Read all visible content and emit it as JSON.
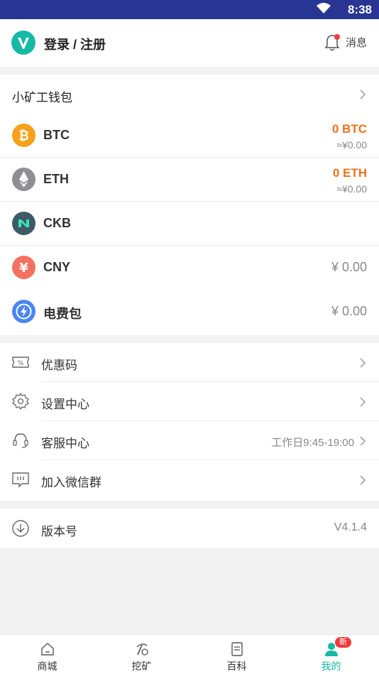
{
  "status_bar": {
    "time": "8:38",
    "background": "#283593"
  },
  "header": {
    "login_label": "登录 / 注册",
    "message_label": "消息"
  },
  "wallet": {
    "title": "小矿工钱包",
    "coins": [
      {
        "name": "BTC",
        "amount": "0 BTC",
        "fiat": "≈¥0.00",
        "color": "#f7a21b"
      },
      {
        "name": "ETH",
        "amount": "0 ETH",
        "fiat": "≈¥0.00",
        "color": "#8e8e93"
      },
      {
        "name": "CKB",
        "amount": "",
        "fiat": "",
        "color": "#3d5a66"
      },
      {
        "name": "CNY",
        "value": "¥ 0.00",
        "color": "#f4715f"
      },
      {
        "name": "电费包",
        "value": "¥ 0.00",
        "color": "#4a86f0"
      }
    ]
  },
  "menu": {
    "items": [
      {
        "label": "优惠码",
        "icon": "coupon-icon"
      },
      {
        "label": "设置中心",
        "icon": "gear-icon"
      },
      {
        "label": "客服中心",
        "extra": "工作日9:45-19:00",
        "icon": "headset-icon"
      },
      {
        "label": "加入微信群",
        "icon": "chat-icon"
      }
    ]
  },
  "version": {
    "label": "版本号",
    "value": "V4.1.4"
  },
  "tabbar": {
    "tabs": [
      {
        "label": "商城",
        "icon": "home-icon"
      },
      {
        "label": "挖矿",
        "icon": "pickaxe-icon"
      },
      {
        "label": "百科",
        "icon": "book-icon"
      },
      {
        "label": "我的",
        "icon": "user-icon",
        "badge": "新"
      }
    ],
    "active_color": "#16b8a6"
  },
  "colors": {
    "accent": "#16b8a6",
    "amount_orange": "#f07019"
  }
}
